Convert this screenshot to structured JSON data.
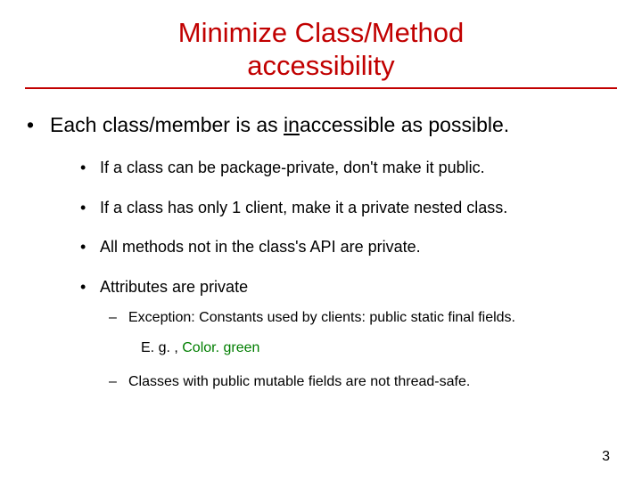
{
  "title": {
    "line1": "Minimize Class/Method",
    "line2": "accessibility"
  },
  "main_bullet": {
    "pre": "Each class/member is as ",
    "emph": "in",
    "post": "accessible as possible."
  },
  "sub_bullets": [
    "If a class can be package-private, don't make it public.",
    "If a class has only 1 client, make it a private nested class.",
    "All methods not in the class's API are private.",
    "Attributes are private"
  ],
  "tertiary": {
    "item1": "Exception: Constants used by clients: public static final fields.",
    "eg_label": "E. g. , ",
    "eg_value": "Color. green",
    "item2": "Classes with public mutable fields are not thread-safe."
  },
  "page_number": "3"
}
